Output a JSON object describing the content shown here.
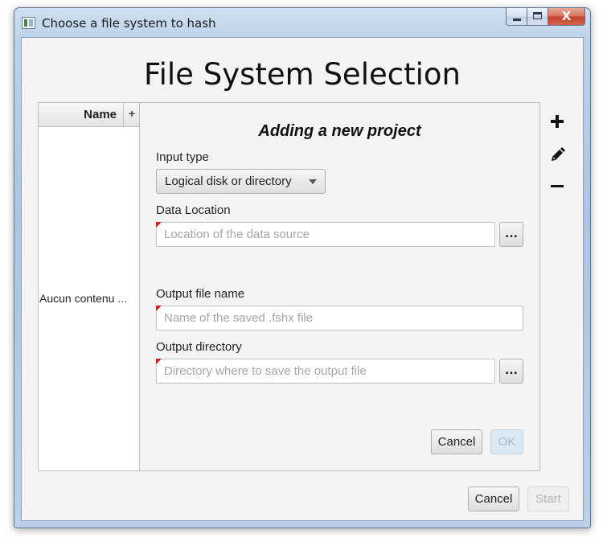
{
  "window": {
    "title": "Choose a file system to hash",
    "close_glyph": "X"
  },
  "page": {
    "title": "File System Selection"
  },
  "project_list": {
    "column_name": "Name",
    "column_add": "+",
    "empty_text": "Aucun contenu ..."
  },
  "form": {
    "title": "Adding a new project",
    "input_type_label": "Input type",
    "input_type_value": "Logical disk or directory",
    "data_location_label": "Data Location",
    "data_location_placeholder": "Location of the data source",
    "data_location_browse": "...",
    "output_file_label": "Output file name",
    "output_file_placeholder": "Name of the saved .fshx file",
    "output_dir_label": "Output directory",
    "output_dir_placeholder": "Directory where to save the output file",
    "output_dir_browse": "...",
    "cancel_label": "Cancel",
    "ok_label": "OK"
  },
  "side_tools": {
    "add_icon": "plus-icon",
    "edit_icon": "pencil-icon",
    "remove_icon": "minus-icon"
  },
  "footer": {
    "cancel_label": "Cancel",
    "start_label": "Start"
  },
  "colors": {
    "required_marker": "#d62020",
    "ok_disabled_bg": "#d9e8f3"
  }
}
